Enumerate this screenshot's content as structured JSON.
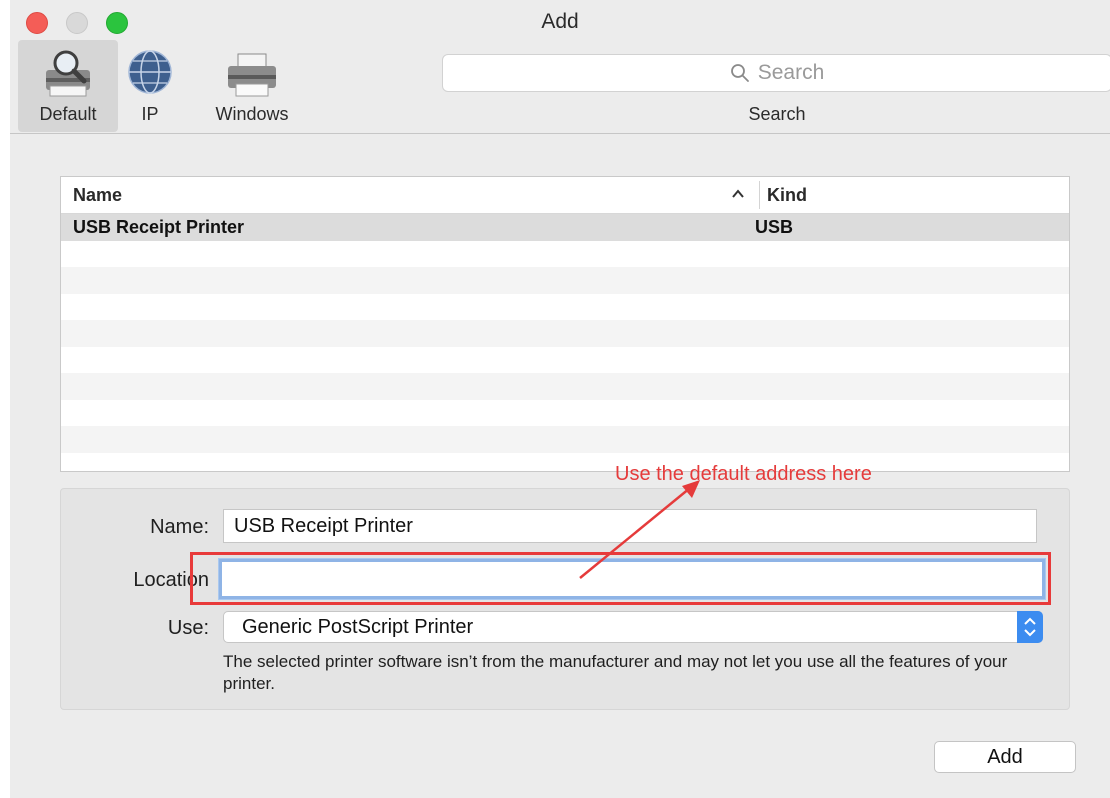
{
  "window": {
    "title": "Add"
  },
  "toolbar": {
    "tabs": [
      {
        "label": "Default",
        "icon": "magnifier-printer-icon",
        "selected": true
      },
      {
        "label": "IP",
        "icon": "globe-icon"
      },
      {
        "label": "Windows",
        "icon": "printer-icon"
      }
    ],
    "search": {
      "placeholder": "Search",
      "label": "Search",
      "icon": "search-icon"
    }
  },
  "printer_list": {
    "columns": [
      {
        "label": "Name",
        "sorted": "ascending"
      },
      {
        "label": "Kind"
      }
    ],
    "rows": [
      {
        "name": "USB Receipt Printer",
        "kind": "USB",
        "selected": true
      }
    ]
  },
  "form": {
    "name": {
      "label": "Name:",
      "value": "USB Receipt Printer"
    },
    "location": {
      "label": "Location",
      "value": ""
    },
    "use": {
      "label": "Use:",
      "value": "Generic PostScript Printer"
    },
    "note": "The selected printer software isn’t from the manufacturer and may not let you use all the features of your printer."
  },
  "buttons": {
    "add": "Add"
  },
  "annotation": {
    "text": "Use the default address here",
    "color": "#e53b3b"
  },
  "colors": {
    "accent": "#3c8cf0",
    "close": "#f45d57",
    "zoom": "#2bc43e"
  }
}
